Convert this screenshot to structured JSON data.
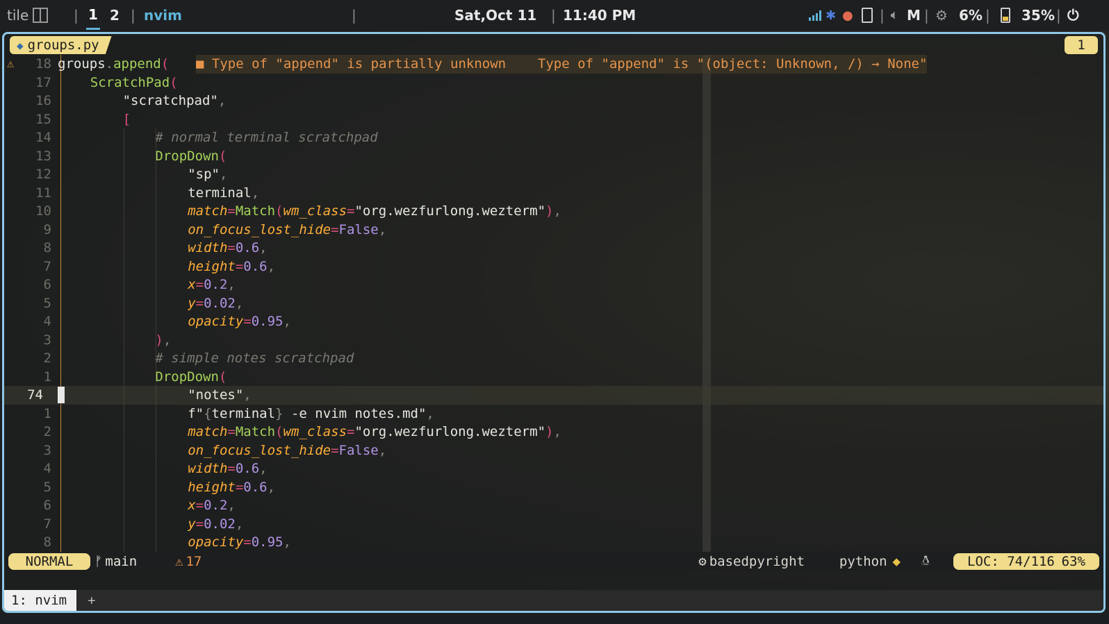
{
  "topbar": {
    "layout": "tile",
    "workspaces": [
      "1",
      "2"
    ],
    "active_workspace": "1",
    "window_title": "nvim",
    "date": "Sat,Oct 11",
    "time": "11:40 PM",
    "volume_label": "M",
    "cpu": "6%",
    "battery": "35%",
    "icons": [
      "signal-icon",
      "bluetooth-icon",
      "tray-app-icon",
      "battery-icon",
      "volume-icon",
      "cpu-gear-icon",
      "battery-level-icon",
      "power-icon"
    ],
    "accent": "#5fb3d9"
  },
  "editor": {
    "tab_file": "groups.py",
    "buffer_number": "1",
    "diagnostic_1": "■ Type of \"append\" is partially unknown",
    "diagnostic_2": "Type of \"append\" is \"(object: Unknown, /) → None\"",
    "lines": [
      {
        "n": "18",
        "sign": "⚠",
        "code": [
          [
            "c-def",
            "groups"
          ],
          [
            "c-punc",
            "."
          ],
          [
            "c-fn",
            "append"
          ],
          [
            "c-paren",
            "("
          ]
        ],
        "indent": 0
      },
      {
        "n": "17",
        "code": [
          [
            "c-fn",
            "ScratchPad"
          ],
          [
            "c-paren",
            "("
          ]
        ],
        "indent": 1
      },
      {
        "n": "16",
        "code": [
          [
            "c-str",
            "\"scratchpad\""
          ],
          [
            "c-punc",
            ","
          ]
        ],
        "indent": 2
      },
      {
        "n": "15",
        "code": [
          [
            "c-paren",
            "["
          ]
        ],
        "indent": 2
      },
      {
        "n": "14",
        "code": [
          [
            "c-cmt",
            "# normal terminal scratchpad"
          ]
        ],
        "indent": 3
      },
      {
        "n": "13",
        "code": [
          [
            "c-fn",
            "DropDown"
          ],
          [
            "c-paren",
            "("
          ]
        ],
        "indent": 3
      },
      {
        "n": "12",
        "code": [
          [
            "c-str",
            "\"sp\""
          ],
          [
            "c-punc",
            ","
          ]
        ],
        "indent": 4
      },
      {
        "n": "11",
        "code": [
          [
            "c-def",
            "terminal"
          ],
          [
            "c-punc",
            ","
          ]
        ],
        "indent": 4
      },
      {
        "n": "10",
        "code": [
          [
            "c-kw",
            "match"
          ],
          [
            "c-op",
            "="
          ],
          [
            "c-fn",
            "Match"
          ],
          [
            "c-paren",
            "("
          ],
          [
            "c-kw",
            "wm_class"
          ],
          [
            "c-op",
            "="
          ],
          [
            "c-str",
            "\"org.wezfurlong.wezterm\""
          ],
          [
            "c-paren",
            ")"
          ],
          [
            "c-punc",
            ","
          ]
        ],
        "indent": 4
      },
      {
        "n": "9",
        "code": [
          [
            "c-kw",
            "on_focus_lost_hide"
          ],
          [
            "c-op",
            "="
          ],
          [
            "c-num",
            "False"
          ],
          [
            "c-punc",
            ","
          ]
        ],
        "indent": 4
      },
      {
        "n": "8",
        "code": [
          [
            "c-kw",
            "width"
          ],
          [
            "c-op",
            "="
          ],
          [
            "c-num",
            "0.6"
          ],
          [
            "c-punc",
            ","
          ]
        ],
        "indent": 4
      },
      {
        "n": "7",
        "code": [
          [
            "c-kw",
            "height"
          ],
          [
            "c-op",
            "="
          ],
          [
            "c-num",
            "0.6"
          ],
          [
            "c-punc",
            ","
          ]
        ],
        "indent": 4
      },
      {
        "n": "6",
        "code": [
          [
            "c-kw",
            "x"
          ],
          [
            "c-op",
            "="
          ],
          [
            "c-num",
            "0.2"
          ],
          [
            "c-punc",
            ","
          ]
        ],
        "indent": 4
      },
      {
        "n": "5",
        "code": [
          [
            "c-kw",
            "y"
          ],
          [
            "c-op",
            "="
          ],
          [
            "c-num",
            "0.02"
          ],
          [
            "c-punc",
            ","
          ]
        ],
        "indent": 4
      },
      {
        "n": "4",
        "code": [
          [
            "c-kw",
            "opacity"
          ],
          [
            "c-op",
            "="
          ],
          [
            "c-num",
            "0.95"
          ],
          [
            "c-punc",
            ","
          ]
        ],
        "indent": 4
      },
      {
        "n": "3",
        "code": [
          [
            "c-paren",
            ")"
          ],
          [
            "c-punc",
            ","
          ]
        ],
        "indent": 3
      },
      {
        "n": "2",
        "code": [
          [
            "c-cmt",
            "# simple notes scratchpad"
          ]
        ],
        "indent": 3
      },
      {
        "n": "1",
        "code": [
          [
            "c-fn",
            "DropDown"
          ],
          [
            "c-paren",
            "("
          ]
        ],
        "indent": 3
      },
      {
        "n": "74",
        "cur": true,
        "code": [
          [
            "c-str",
            "\"notes\""
          ],
          [
            "c-punc",
            ","
          ]
        ],
        "indent": 4
      },
      {
        "n": "1",
        "code": [
          [
            "c-str",
            "f\""
          ],
          [
            "c-brace",
            "{"
          ],
          [
            "c-def",
            "terminal"
          ],
          [
            "c-brace",
            "}"
          ],
          [
            "c-str",
            " -e nvim notes.md\""
          ],
          [
            "c-punc",
            ","
          ]
        ],
        "indent": 4
      },
      {
        "n": "2",
        "code": [
          [
            "c-kw",
            "match"
          ],
          [
            "c-op",
            "="
          ],
          [
            "c-fn",
            "Match"
          ],
          [
            "c-paren",
            "("
          ],
          [
            "c-kw",
            "wm_class"
          ],
          [
            "c-op",
            "="
          ],
          [
            "c-str",
            "\"org.wezfurlong.wezterm\""
          ],
          [
            "c-paren",
            ")"
          ],
          [
            "c-punc",
            ","
          ]
        ],
        "indent": 4
      },
      {
        "n": "3",
        "code": [
          [
            "c-kw",
            "on_focus_lost_hide"
          ],
          [
            "c-op",
            "="
          ],
          [
            "c-num",
            "False"
          ],
          [
            "c-punc",
            ","
          ]
        ],
        "indent": 4
      },
      {
        "n": "4",
        "code": [
          [
            "c-kw",
            "width"
          ],
          [
            "c-op",
            "="
          ],
          [
            "c-num",
            "0.6"
          ],
          [
            "c-punc",
            ","
          ]
        ],
        "indent": 4
      },
      {
        "n": "5",
        "code": [
          [
            "c-kw",
            "height"
          ],
          [
            "c-op",
            "="
          ],
          [
            "c-num",
            "0.6"
          ],
          [
            "c-punc",
            ","
          ]
        ],
        "indent": 4
      },
      {
        "n": "6",
        "code": [
          [
            "c-kw",
            "x"
          ],
          [
            "c-op",
            "="
          ],
          [
            "c-num",
            "0.2"
          ],
          [
            "c-punc",
            ","
          ]
        ],
        "indent": 4
      },
      {
        "n": "7",
        "code": [
          [
            "c-kw",
            "y"
          ],
          [
            "c-op",
            "="
          ],
          [
            "c-num",
            "0.02"
          ],
          [
            "c-punc",
            ","
          ]
        ],
        "indent": 4
      },
      {
        "n": "8",
        "code": [
          [
            "c-kw",
            "opacity"
          ],
          [
            "c-op",
            "="
          ],
          [
            "c-num",
            "0.95"
          ],
          [
            "c-punc",
            ","
          ]
        ],
        "indent": 4
      }
    ]
  },
  "statusline": {
    "mode": "NORMAL",
    "branch": "main",
    "warnings": "17",
    "lsp": "basedpyright",
    "filetype": "python",
    "loc": "LOC: 74/116",
    "percent": "63%"
  },
  "terminal_tabs": {
    "active": "1: nvim",
    "new_tab": "+"
  }
}
